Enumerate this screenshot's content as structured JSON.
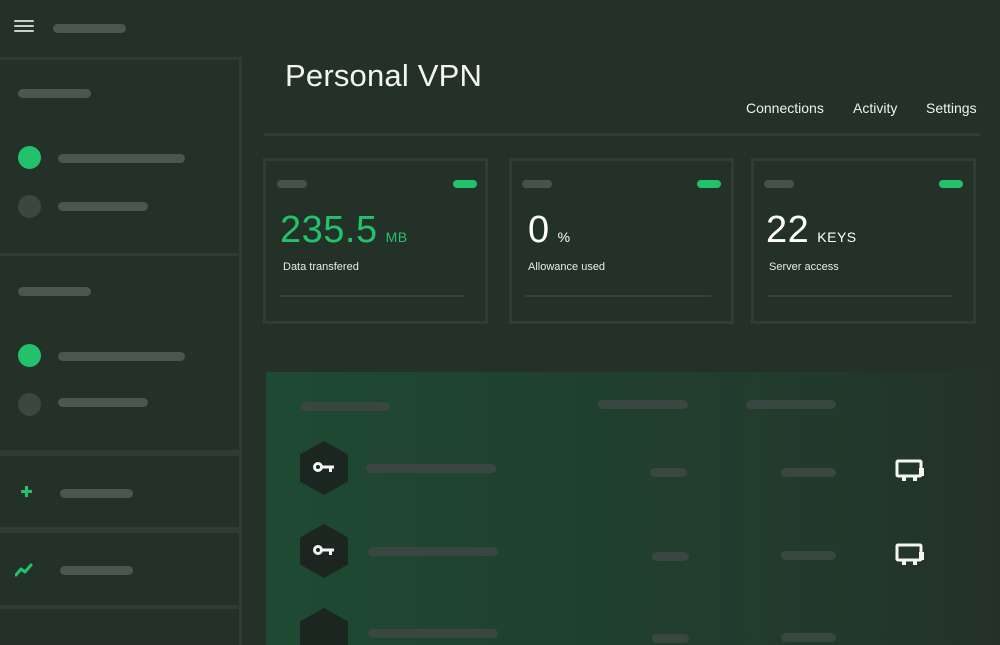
{
  "header": {
    "menu_icon": "hamburger-icon"
  },
  "page": {
    "title": "Personal VPN"
  },
  "nav": {
    "items": [
      {
        "label": "Connections"
      },
      {
        "label": "Activity"
      },
      {
        "label": "Settings"
      }
    ]
  },
  "stats": [
    {
      "value": "235.5",
      "unit": "MB",
      "label": "Data transfered",
      "accent": "#23c16b"
    },
    {
      "value": "0",
      "unit": "%",
      "label": "Allowance used",
      "accent": "#ffffff"
    },
    {
      "value": "22",
      "unit": "KEYS",
      "label": "Server access",
      "accent": "#ffffff"
    }
  ],
  "sidebar": {
    "icons": [
      "plus-icon",
      "trend-icon"
    ]
  },
  "table": {
    "row_icons": [
      "key-icon",
      "key-icon",
      "key-icon"
    ],
    "action_icon": "monitor-icon"
  },
  "colors": {
    "background": "#243129",
    "accent": "#23c16b",
    "panel": "#1e4a33"
  }
}
